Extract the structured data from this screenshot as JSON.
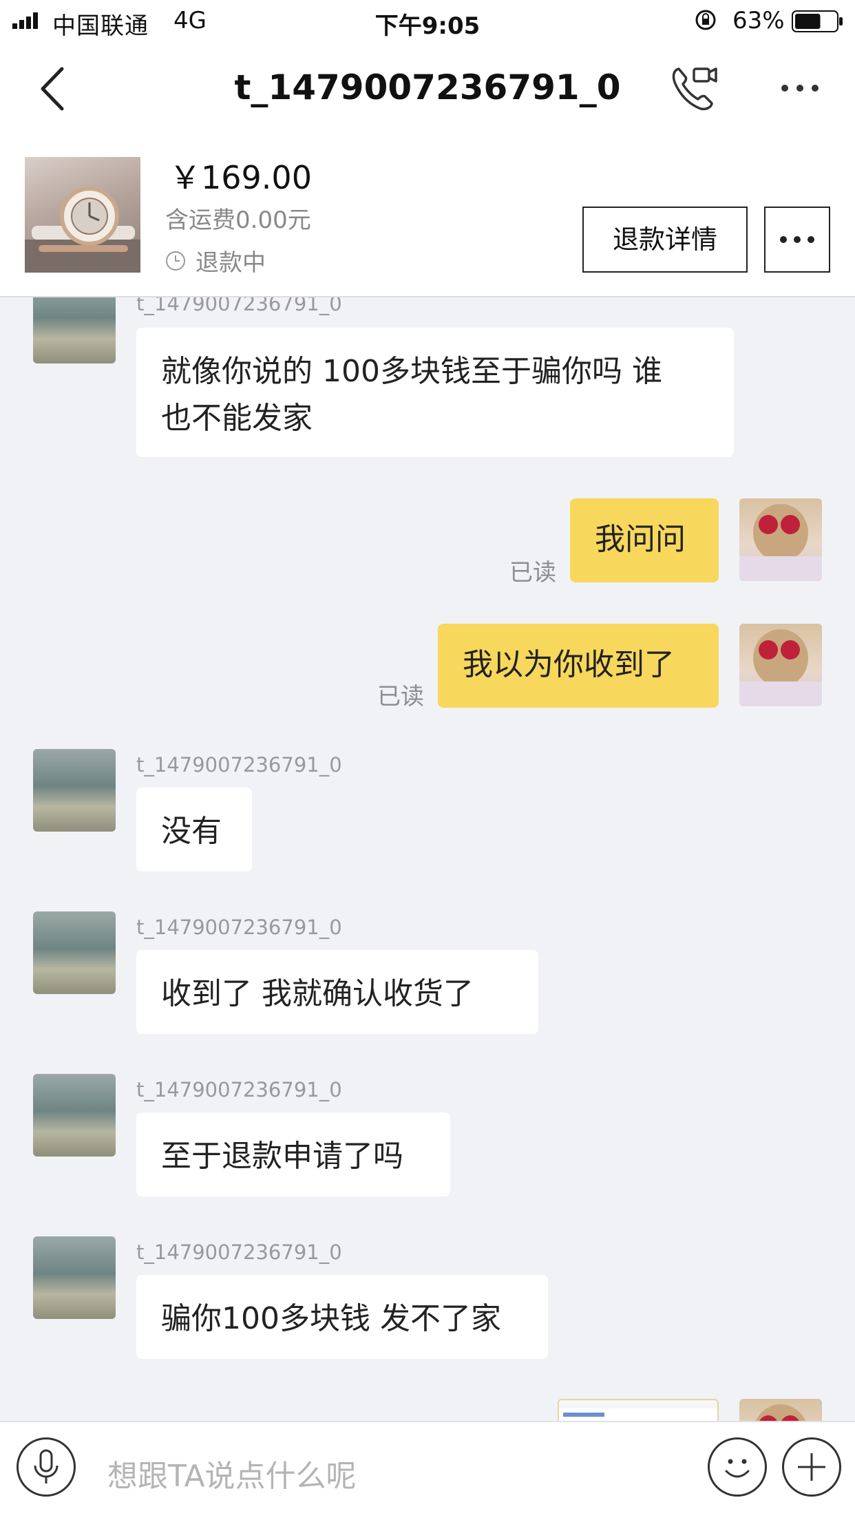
{
  "status_bar": {
    "carrier": "中国联通",
    "network": "4G",
    "time": "下午9:05",
    "battery": "63%",
    "battery_level": 0.63
  },
  "header": {
    "title": "t_1479007236791_0",
    "icons": [
      "back-icon",
      "video-call-icon",
      "more-icon"
    ]
  },
  "order": {
    "price": "￥169.00",
    "shipping": "含运费0.00元",
    "status": "退款中",
    "refund_button": "退款详情"
  },
  "messages": [
    {
      "side": "in",
      "sender": "t_1479007236791_0",
      "lines": [
        "就像你说的 100多块钱至于骗你吗  谁",
        "也不能发家"
      ]
    },
    {
      "side": "out",
      "text": "我问问",
      "read": "已读"
    },
    {
      "side": "out",
      "text": "我以为你收到了",
      "read": "已读"
    },
    {
      "side": "in",
      "sender": "t_1479007236791_0",
      "lines": [
        "没有"
      ]
    },
    {
      "side": "in",
      "sender": "t_1479007236791_0",
      "lines": [
        "收到了  我就确认收货了"
      ]
    },
    {
      "side": "in",
      "sender": "t_1479007236791_0",
      "lines": [
        "至于退款申请了吗"
      ]
    },
    {
      "side": "in",
      "sender": "t_1479007236791_0",
      "lines": [
        "骗你100多块钱 发不了家"
      ]
    }
  ],
  "input": {
    "placeholder": "想跟TA说点什么呢"
  },
  "colors": {
    "outgoing_bubble": "#f7d75c",
    "background": "#f1f2f6"
  }
}
